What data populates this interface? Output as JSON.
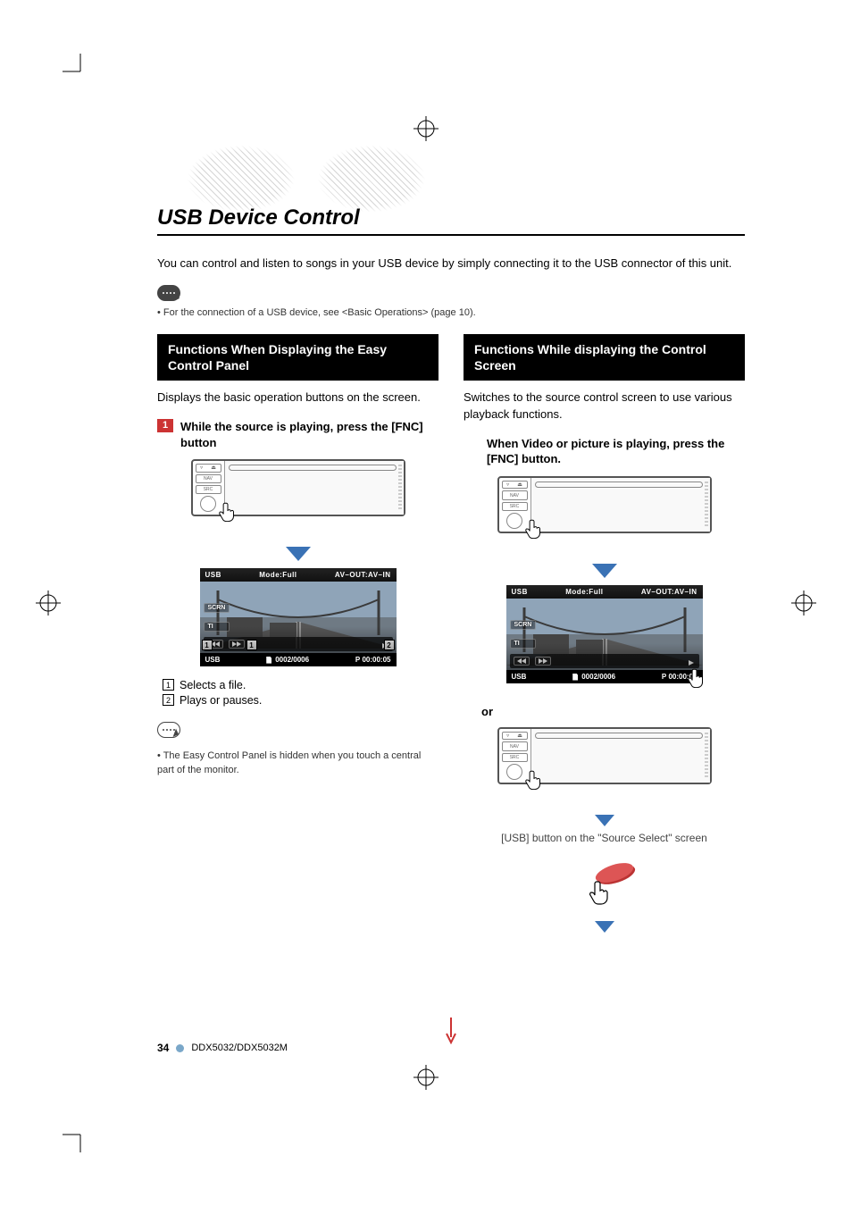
{
  "page": {
    "number": "34",
    "model": "DDX5032/DDX5032M"
  },
  "title": "USB Device Control",
  "intro": "You can control and listen to songs in your USB device by simply connecting it to the USB connector of this unit.",
  "global_note": "• For the connection of a USB device, see <Basic Operations> (page 10).",
  "left": {
    "heading": "Functions When Displaying the Easy Control Panel",
    "desc": "Displays the basic operation buttons on the screen.",
    "step_num": "1",
    "step_text": "While the source is playing, press the [FNC] button",
    "shot": {
      "source": "USB",
      "mode": "Mode:Full",
      "avout": "AV–OUT:AV–IN",
      "scrn": "SCRN",
      "ti": "TI",
      "file_count": "0002/0006",
      "time_prefix": "P",
      "time": "00:00:05",
      "callout1": "1",
      "callout2": "2"
    },
    "legend1_num": "1",
    "legend1": "Selects a file.",
    "legend2_num": "2",
    "legend2": "Plays or pauses.",
    "note": "• The Easy Control Panel is hidden when you touch a central part of the monitor."
  },
  "right": {
    "heading": "Functions While displaying the Control Screen",
    "desc": "Switches to the source control screen to use various playback functions.",
    "step_text": "When Video or picture is playing, press the [FNC] button.",
    "shot": {
      "source": "USB",
      "mode": "Mode:Full",
      "avout": "AV–OUT:AV–IN",
      "scrn": "SCRN",
      "ti": "TI",
      "file_count": "0002/0006",
      "time_prefix": "P",
      "time": "00:00:05"
    },
    "or": "or",
    "caption": "[USB] button on the \"Source Select\" screen"
  }
}
